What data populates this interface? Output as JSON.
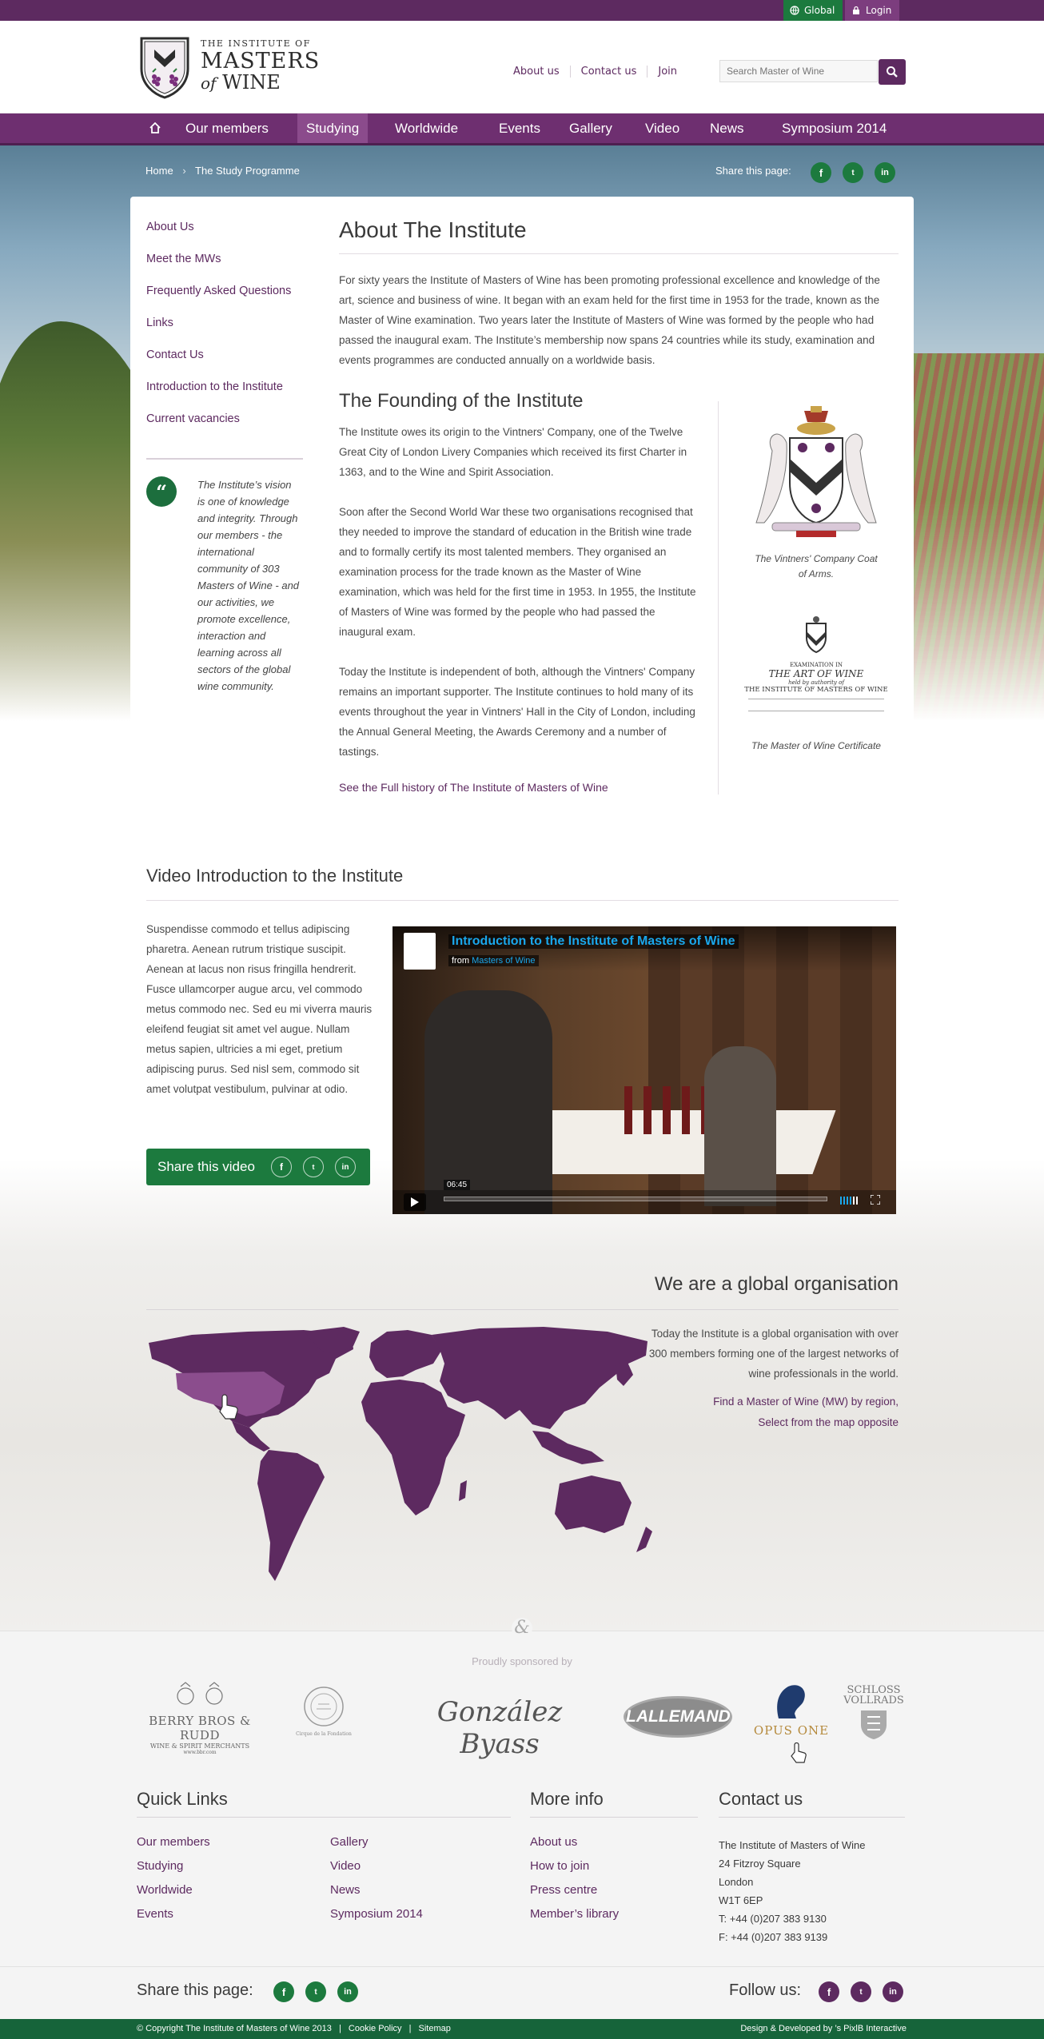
{
  "topbar": {
    "global_label": "Global",
    "login_label": "Login"
  },
  "logo": {
    "line1": "The Institute of",
    "line2": "MASTERS",
    "line3_of": "of",
    "line3_wine": "WINE"
  },
  "header": {
    "links": [
      "About us",
      "Contact us",
      "Join"
    ],
    "search_placeholder": "Search Master of Wine"
  },
  "nav": {
    "home_icon": "home-icon",
    "items": [
      "Our members",
      "Studying",
      "Worldwide",
      "Events",
      "Gallery",
      "Video",
      "News",
      "Symposium 2014"
    ],
    "active": "Studying"
  },
  "breadcrumb": {
    "home": "Home",
    "separator": "›",
    "current": "The Study Programme"
  },
  "share_top": {
    "label": "Share this page:",
    "icons": [
      "f",
      "t",
      "in"
    ]
  },
  "sidebar": {
    "items": [
      "About Us",
      "Meet the MWs",
      "Frequently Asked Questions",
      "Links",
      "Contact Us",
      "Introduction to the Institute",
      "Current vacancies"
    ],
    "quote_mark": "“",
    "quote": "The Institute’s vision is one of knowledge and integrity. Through our members - the international community of 303 Masters of Wine - and our activities, we promote excellence, interaction and learning across all sectors of the global wine community."
  },
  "main": {
    "title": "About The Institute",
    "intro": "For sixty years the Institute of Masters of Wine has been promoting professional excellence and knowledge of the art, science and business of wine. It began with an exam held for the first time in 1953 for the trade, known as the Master of Wine examination. Two years later the Institute of Masters of Wine was formed by the people who had passed the inaugural exam. The Institute’s membership now spans 24 countries while its study, examination and events programmes are conducted annually on a worldwide basis.",
    "founding_title": "The Founding of the Institute",
    "p1": "The Institute owes its origin to the Vintners' Company, one of the Twelve Great City of London Livery Companies which received its first Charter in 1363, and to the Wine and Spirit Association.",
    "p2": "Soon after the Second World War these two organisations recognised that they needed to improve the standard of education in the British wine trade and to formally certify its most talented members. They organised an examination process for the trade known as the Master of Wine examination, which was held for the first time in 1953. In 1955, the Institute of Masters of Wine was formed by the people who had passed the inaugural exam.",
    "p3": "Today the Institute is independent of both, although the Vintners' Company remains an important supporter. The Institute continues to hold many of its events throughout the year in Vintners' Hall in the City of London, including the Annual General Meeting, the Awards Ceremony and a number of tastings.",
    "full_history_link": "See the Full history of The Institute of Masters of Wine",
    "coat_caption": "The Vintners' Company Coat of Arms.",
    "cert_caption": "The Master of Wine Certificate",
    "cert_lines": [
      "EXAMINATION IN",
      "THE ART OF WINE",
      "held by authority of",
      "THE INSTITUTE OF MASTERS OF WINE"
    ]
  },
  "video_section": {
    "title": "Video Introduction to the Institute",
    "text": "Suspendisse commodo et tellus adipiscing pharetra. Aenean rutrum tristique suscipit. Aenean at lacus non risus fringilla hendrerit. Fusce ullamcorper augue arcu, vel commodo metus commodo nec. Sed eu mi viverra mauris eleifend feugiat sit amet vel augue. Nullam metus sapien, ultricies a mi eget, pretium adipiscing purus. Sed nisl sem, commodo sit amet volutpat vestibulum, pulvinar at odio.",
    "share_label": "Share this video",
    "video_title": "Introduction to the Institute of Masters of Wine",
    "video_from": "from",
    "video_channel": "Masters of Wine",
    "duration": "06:45"
  },
  "global": {
    "title": "We are a global organisation",
    "text": "Today the Institute is a global organisation with over 300 members forming one of the largest networks of wine professionals in the world.",
    "link1": "Find a Master of Wine (MW) by region,",
    "link2": "Select from the map opposite"
  },
  "sponsors": {
    "label": "Proudly sponsored by",
    "items": [
      {
        "line1": "BERRY BROS & RUDD",
        "line2": "WINE & SPIRIT MERCHANTS",
        "line3": "www.bbr.com"
      },
      {
        "line1": "Cirque de la Fondation"
      },
      {
        "line1": "González Byass"
      },
      {
        "line1": "LALLEMAND"
      },
      {
        "line1": "OPUS ONE"
      },
      {
        "line1": "SCHLOSS",
        "line2": "VOLLRADS"
      }
    ]
  },
  "footer": {
    "quick_links_title": "Quick Links",
    "quick_links_col1": [
      "Our members",
      "Studying",
      "Worldwide",
      "Events"
    ],
    "quick_links_col2": [
      "Gallery",
      "Video",
      "News",
      "Symposium 2014"
    ],
    "more_info_title": "More info",
    "more_info": [
      "About us",
      "How to join",
      "Press centre",
      "Member’s library"
    ],
    "contact_title": "Contact us",
    "address": [
      "The Institute of Masters of Wine",
      "24 Fitzroy Square",
      "London",
      "W1T 6EP",
      "T: +44 (0)207 383 9130",
      "F: +44 (0)207 383 9139"
    ],
    "share_label": "Share this page:",
    "follow_label": "Follow us:",
    "copyright": "© Copyright The Institute of Masters of Wine 2013",
    "cookie": "Cookie Policy",
    "sitemap": "Sitemap",
    "credit": "Design & Developed by ’s PixlB Interactive"
  },
  "colors": {
    "brand_purple": "#5d2a60",
    "nav_purple": "#6e2f70",
    "green": "#1c7a3e",
    "map_purple": "#5d2a60"
  }
}
